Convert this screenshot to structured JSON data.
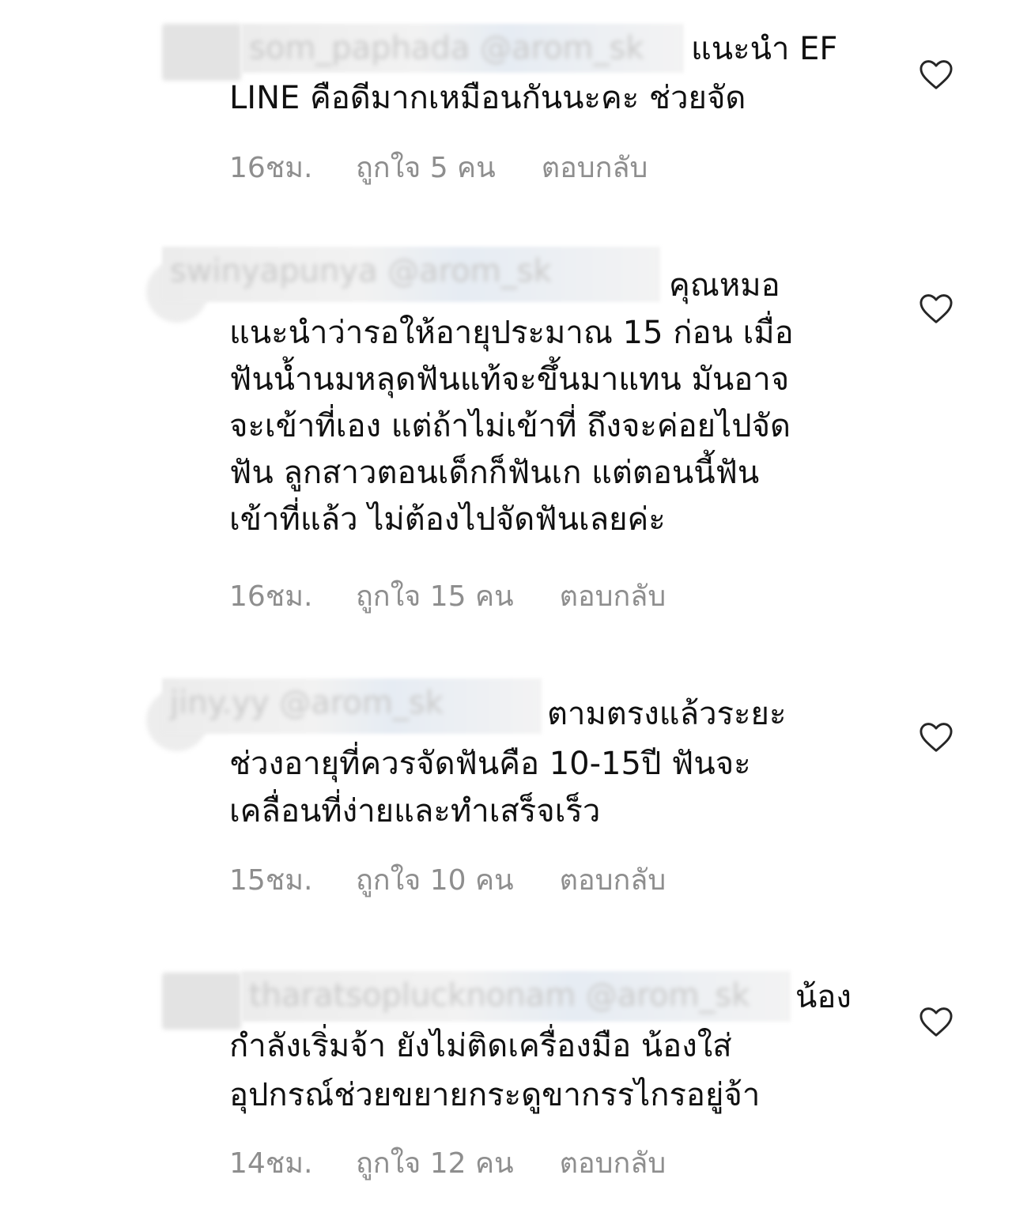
{
  "comments": [
    {
      "username": "som_paphada",
      "mention": "@arom_sk",
      "first_line": "แนะนำ EF",
      "text": "LINE คือดีมากเหมือนกันนะคะ ช่วยจัด",
      "time": "16ชม.",
      "likes": "ถูกใจ 5 คน",
      "reply": "ตอบกลับ"
    },
    {
      "username": "swinyapunya",
      "mention": "@arom_sk",
      "first_line": "คุณหมอ",
      "text": "แนะนำว่ารอให้อายุประมาณ 15 ก่อน เมื่อ ฟันน้ำนมหลุดฟันแท้จะขึ้นมาแทน มันอาจ จะเข้าที่เอง แต่ถ้าไม่เข้าที่ ถึงจะค่อยไปจัด ฟัน ลูกสาวตอนเด็กก็ฟันเก แต่ตอนนี้ฟัน เข้าที่แล้ว ไม่ต้องไปจัดฟันเลยค่ะ",
      "lines": [
        "แนะนำว่ารอให้อายุประมาณ 15 ก่อน เมื่อ",
        "ฟันน้ำนมหลุดฟันแท้จะขึ้นมาแทน มันอาจ",
        "จะเข้าที่เอง แต่ถ้าไม่เข้าที่ ถึงจะค่อยไปจัด",
        "ฟัน ลูกสาวตอนเด็กก็ฟันเก แต่ตอนนี้ฟัน",
        "เข้าที่แล้ว ไม่ต้องไปจัดฟันเลยค่ะ"
      ],
      "time": "16ชม.",
      "likes": "ถูกใจ 15 คน",
      "reply": "ตอบกลับ"
    },
    {
      "username": "jiny.yy",
      "mention": "@arom_sk",
      "first_line": "ตามตรงแล้วระยะ",
      "lines": [
        "ช่วงอายุที่ควรจัดฟันคือ 10-15ปี ฟันจะ",
        "เคลื่อนที่ง่ายและทำเสร็จเร็ว"
      ],
      "time": "15ชม.",
      "likes": "ถูกใจ 10 คน",
      "reply": "ตอบกลับ"
    },
    {
      "username": "tharatsoplucknonam",
      "mention": "@arom_sk",
      "first_line": "น้อง",
      "lines": [
        "กำลังเริ่มจ้า ยังไม่ติดเครื่องมือ น้องใส่",
        "อุปกรณ์ช่วยขยายกระดูขากรรไกรอยู่จ้า"
      ],
      "time": "14ชม.",
      "likes": "ถูกใจ 12 คน",
      "reply": "ตอบกลับ"
    }
  ],
  "icons": {
    "like": "heart-outline-icon"
  },
  "colors": {
    "text": "#111111",
    "meta": "#8e8e8e",
    "background": "#ffffff"
  }
}
